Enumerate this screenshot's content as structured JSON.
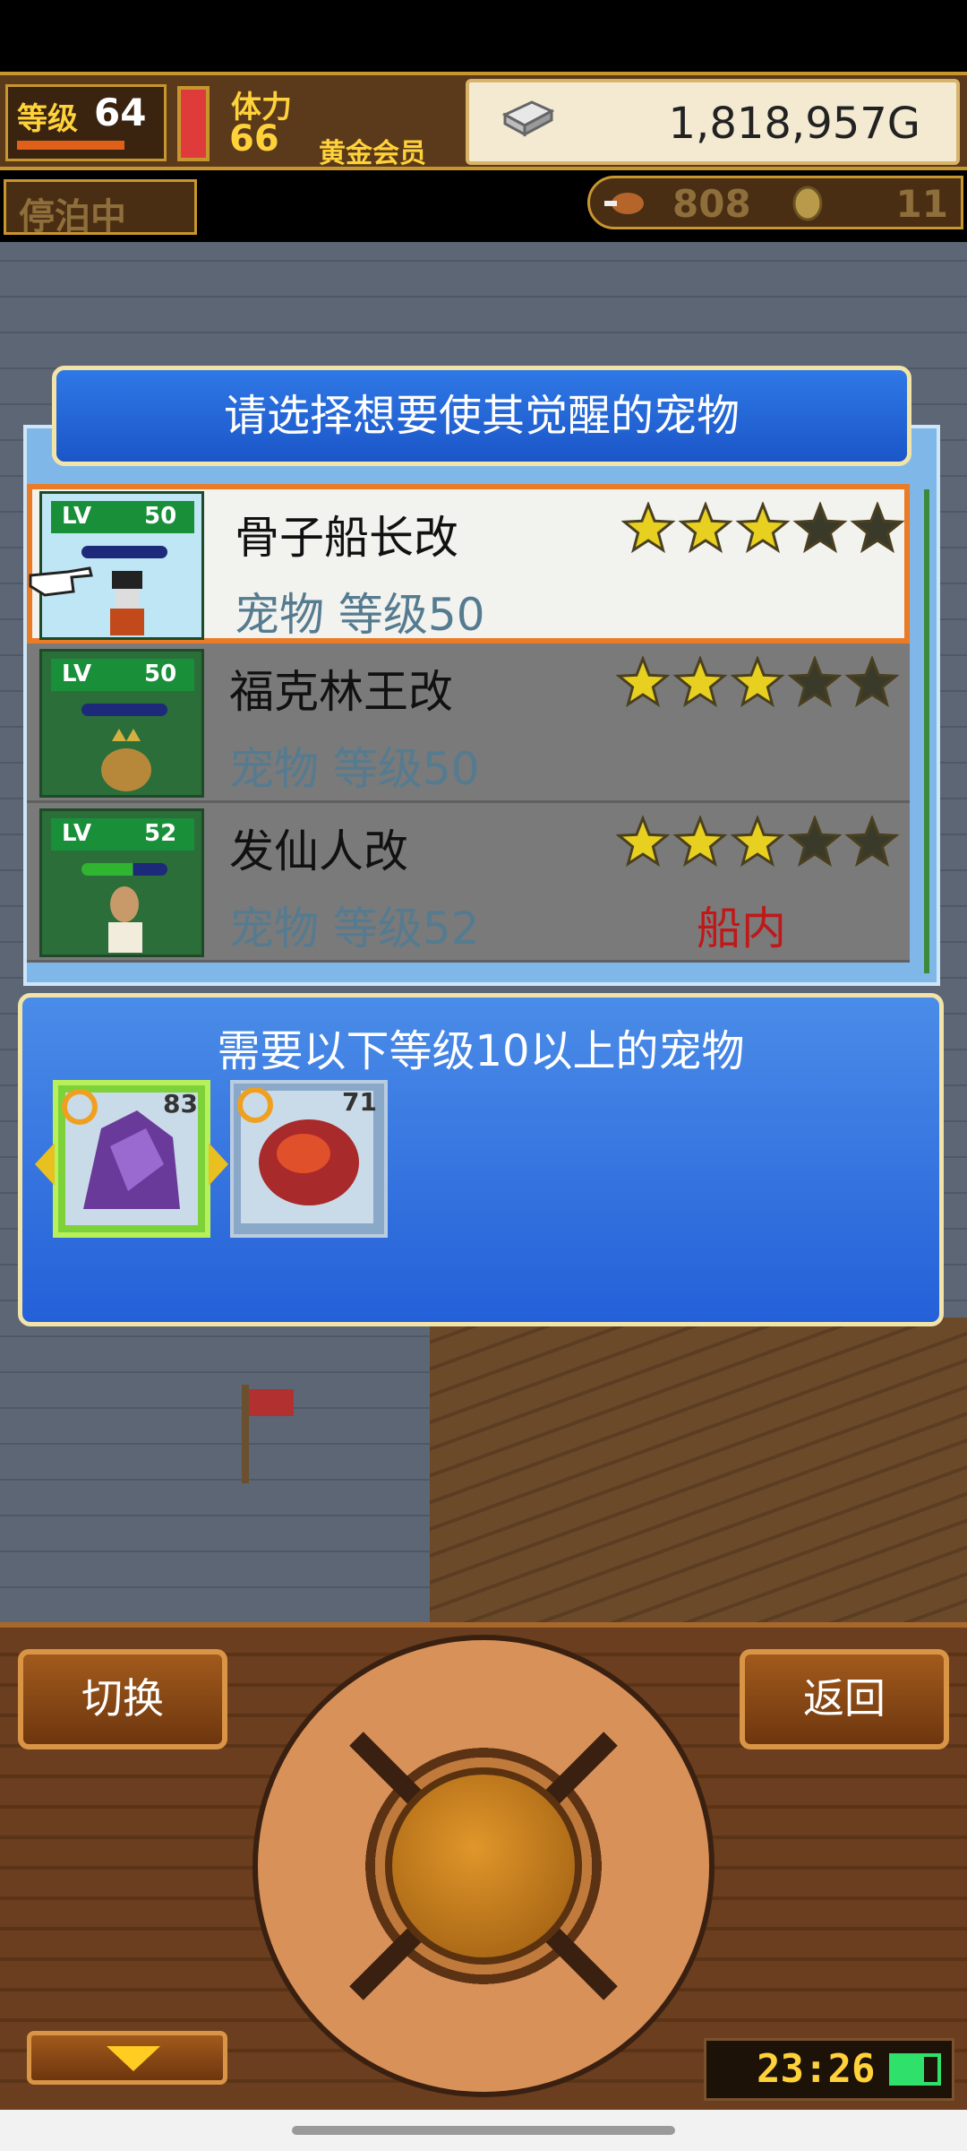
{
  "hud": {
    "level_label": "等级",
    "level_value": "64",
    "stamina_label": "体力",
    "stamina_value": "66",
    "member_label": "黄金会员",
    "money": "1,818,957G",
    "status_label": "停泊中",
    "food_value": "808",
    "coin_value": "11"
  },
  "panel": {
    "title": "请选择想要使其觉醒的宠物",
    "pets": [
      {
        "lv_label": "LV",
        "lv": "50",
        "name": "骨子船长改",
        "sub": "宠物 等级50",
        "location": "",
        "stars_filled": 3,
        "stars_total": 5,
        "selected": true
      },
      {
        "lv_label": "LV",
        "lv": "50",
        "name": "福克林王改",
        "sub": "宠物 等级50",
        "location": "",
        "stars_filled": 3,
        "stars_total": 5,
        "selected": false
      },
      {
        "lv_label": "LV",
        "lv": "52",
        "name": "发仙人改",
        "sub": "宠物 等级52",
        "location": "船内",
        "stars_filled": 3,
        "stars_total": 5,
        "selected": false
      }
    ]
  },
  "requirement": {
    "text": "需要以下等级10以上的宠物",
    "slots": [
      {
        "lv": "83",
        "selected": true
      },
      {
        "lv": "71",
        "selected": false
      }
    ]
  },
  "console": {
    "switch_label": "切换",
    "back_label": "返回",
    "clock": "23:26"
  },
  "colors": {
    "panel_blue": "#1b56c8",
    "selected_border": "#ea7c28",
    "location_red": "#c01818",
    "star_yellow": "#e8d020"
  }
}
